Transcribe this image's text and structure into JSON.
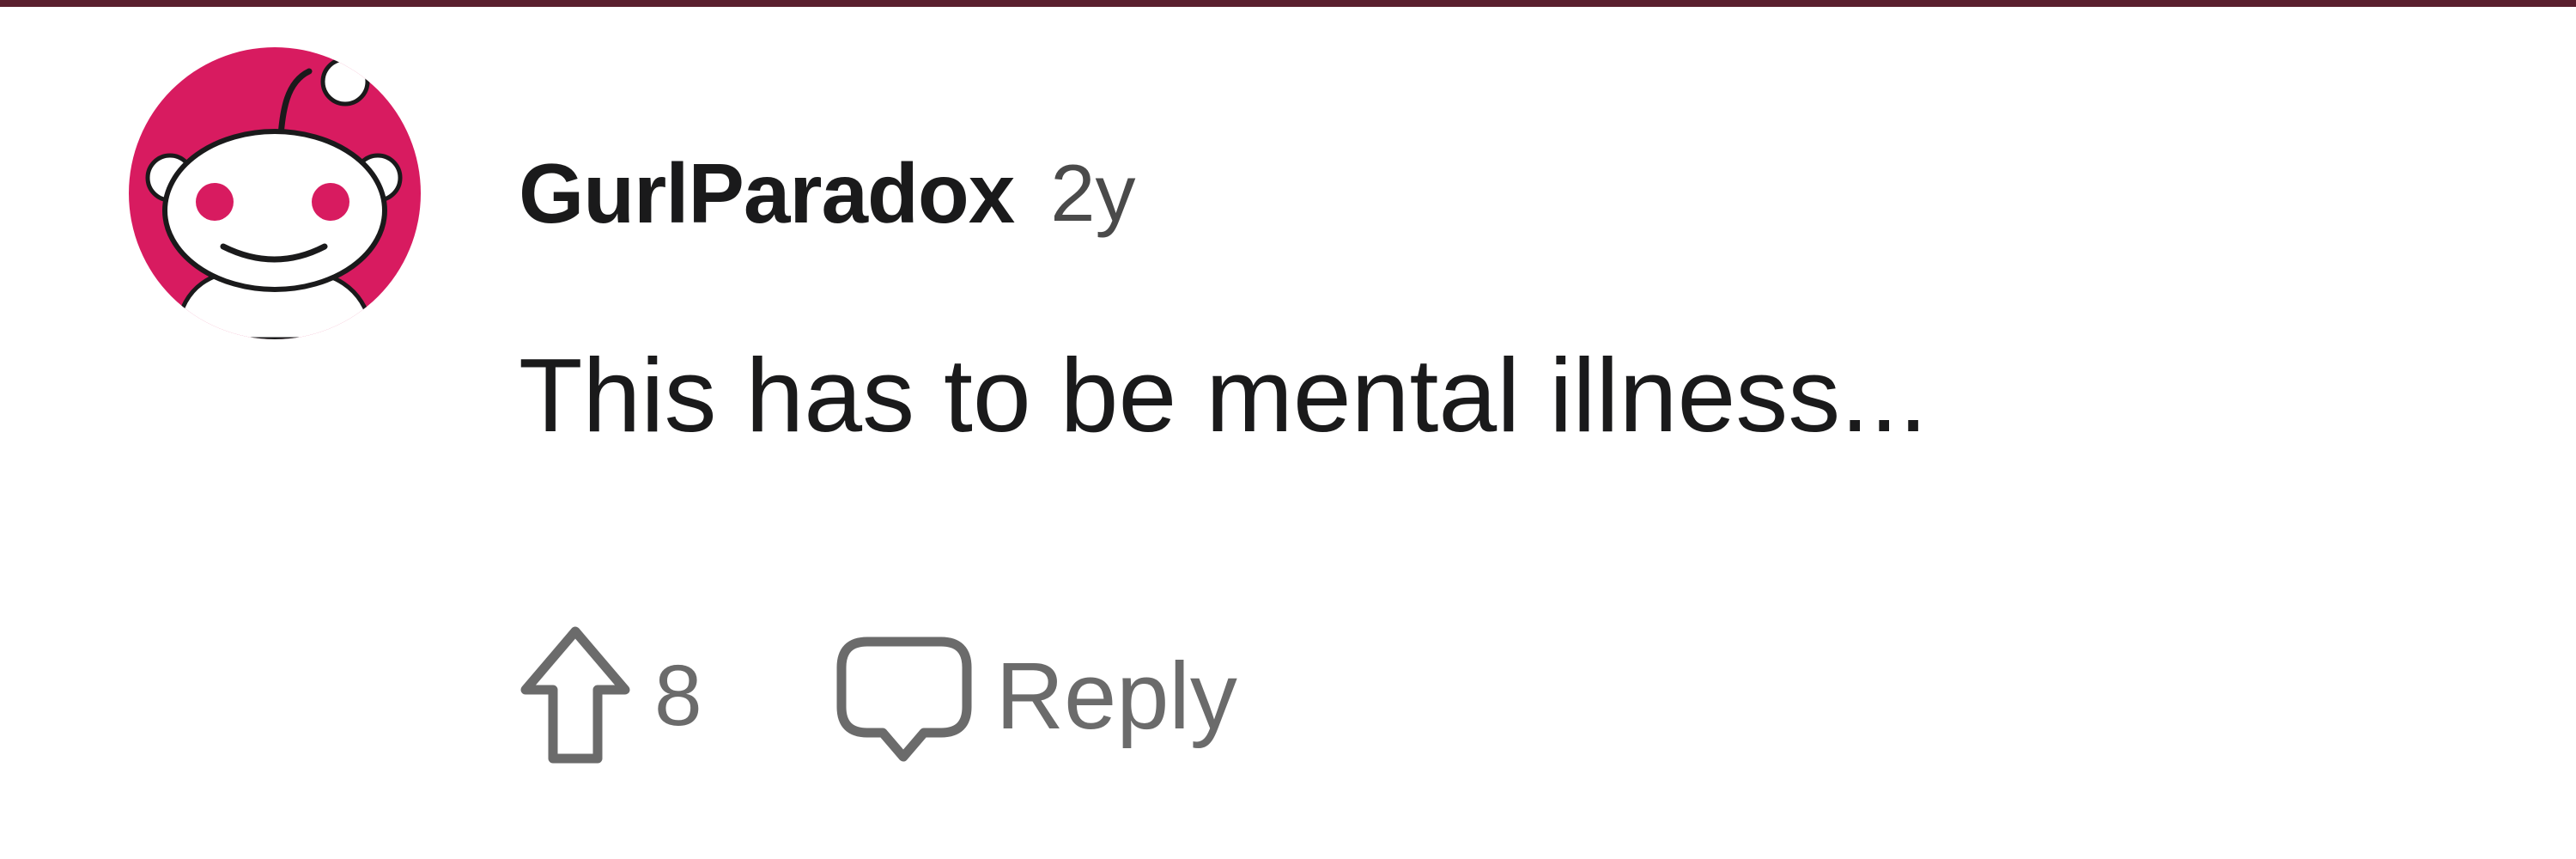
{
  "comment": {
    "username": "GurlParadox",
    "timestamp": "2y",
    "body": "This has to be mental illness...",
    "avatar_icon": "reddit-snoo-avatar-icon",
    "avatar_color": "#d81b60"
  },
  "actions": {
    "upvote_icon": "upvote-arrow-icon",
    "vote_count": "8",
    "reply_icon": "speech-bubble-icon",
    "reply_label": "Reply"
  },
  "colors": {
    "top_rule": "#5a1f2e",
    "text_primary": "#1a1a1b",
    "text_secondary": "#6b6b6b"
  }
}
